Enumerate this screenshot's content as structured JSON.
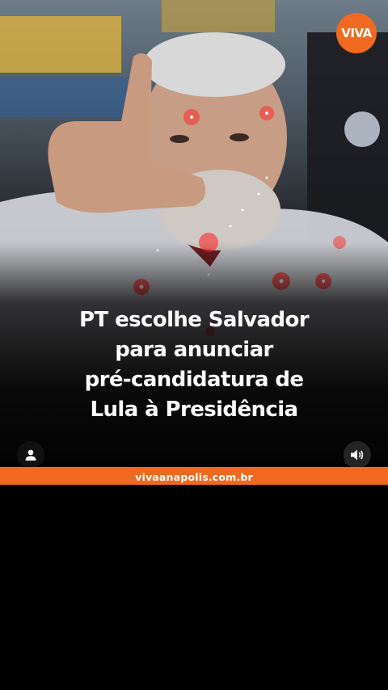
{
  "brand": {
    "logo_text": "VIVA",
    "accent_color": "#ef6a20"
  },
  "headline": {
    "lines": [
      "PT escolhe Salvador",
      "para anunciar",
      "pré-candidatura de",
      "Lula à Presidência"
    ]
  },
  "footer": {
    "url": "vivaanapolis.com.br"
  },
  "controls": {
    "user_icon": "person-icon",
    "sound_icon": "speaker-icon"
  }
}
